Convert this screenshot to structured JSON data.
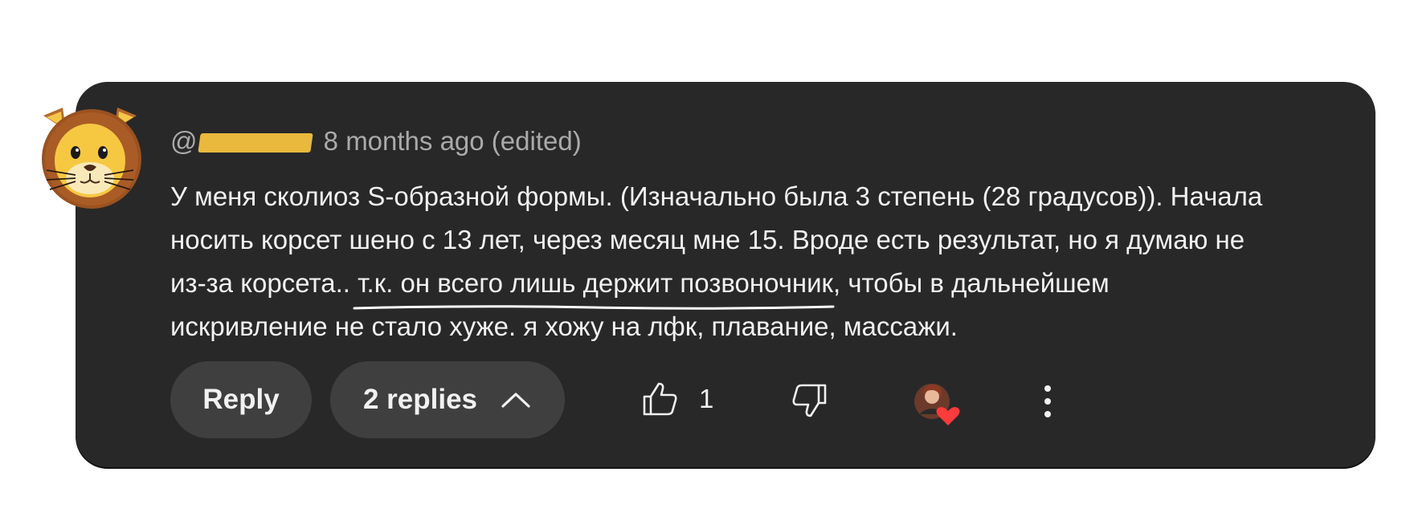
{
  "comment": {
    "handle_prefix": "@",
    "timestamp": "8 months ago (edited)",
    "text_lines": {
      "line1": "У меня сколиоз S-образной формы. (Изначально была 3 степень (28 градусов)). Начала",
      "line2": "носить корсет шено с 13 лет, через месяц мне 15. Вроде есть результат, но я думаю не",
      "line3_before": "из-за корсета.. ",
      "line3_underlined": "т.к. он всего лишь держит позвоночник",
      "line3_after": ", чтобы в дальнейшем",
      "line4": "искривление не стало хуже. я хожу на лфк, плавание, массажи."
    }
  },
  "actions": {
    "reply_label": "Reply",
    "replies_label": "2 replies",
    "like_count": "1"
  },
  "icons": {
    "avatar": "lion-emoji-avatar",
    "like": "thumbs-up-icon",
    "dislike": "thumbs-down-icon",
    "expand": "chevron-up-icon",
    "creator_heart": "creator-heart-icon",
    "more": "more-vertical-icon"
  },
  "colors": {
    "card_background": "#282828",
    "text_primary": "#f1f1f1",
    "text_secondary": "#aaaaaa",
    "button_background": "#3f3f3f",
    "handle_mask": "#e8b93d",
    "heart": "#ff3b3b"
  }
}
